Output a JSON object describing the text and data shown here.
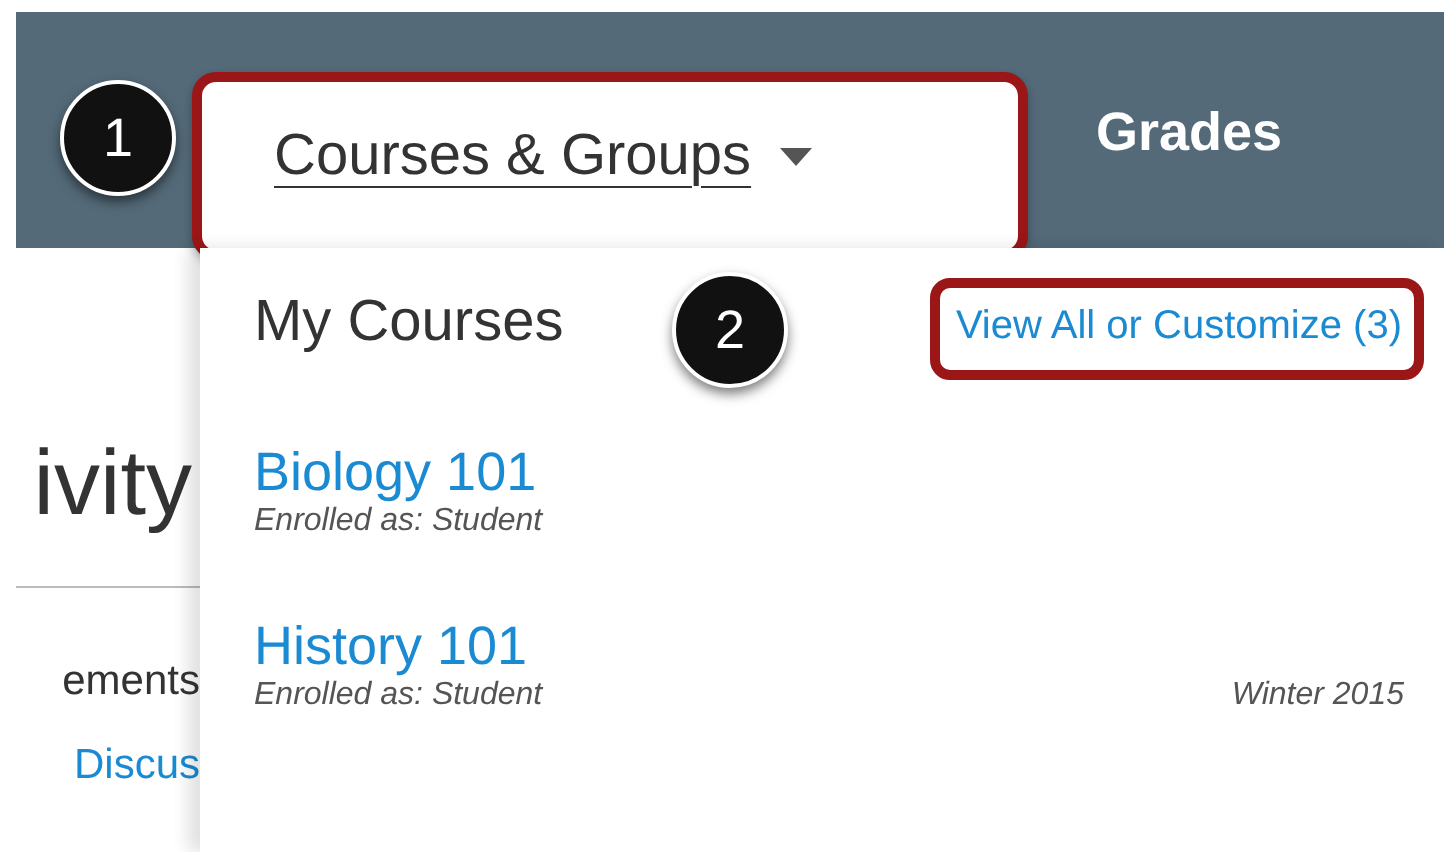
{
  "nav": {
    "items": [
      {
        "label": "Courses & Groups",
        "selected": true,
        "has_menu": true
      },
      {
        "label": "Grades",
        "selected": false,
        "has_menu": false
      }
    ]
  },
  "callouts": [
    {
      "number": "1"
    },
    {
      "number": "2"
    }
  ],
  "page_behind": {
    "heading": "ivity",
    "section": "ements",
    "link": "Discus"
  },
  "dropdown": {
    "title": "My Courses",
    "link": "View All or Customize (3)",
    "courses": [
      {
        "name": "Biology 101",
        "role": "Enrolled as: Student"
      },
      {
        "name": "History 101",
        "role": "Enrolled as: Student",
        "term": "Winter 2015"
      }
    ]
  }
}
